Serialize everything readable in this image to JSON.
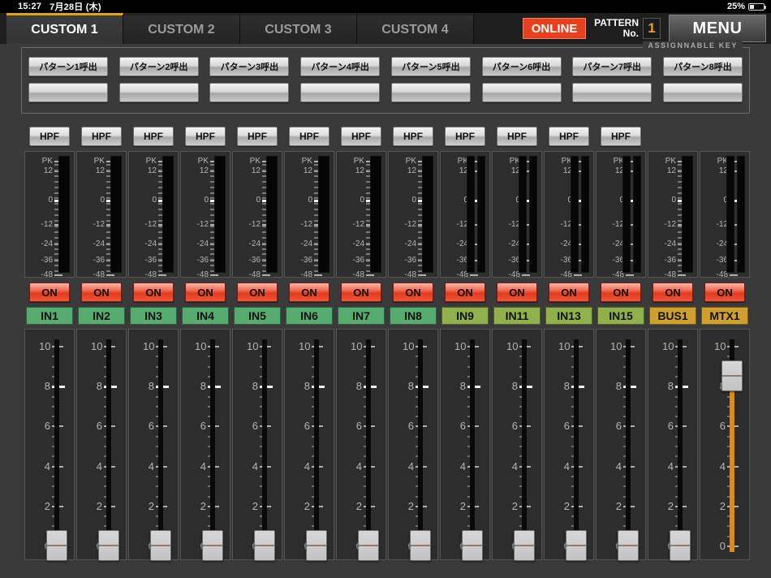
{
  "statusbar": {
    "time": "15:27",
    "date": "7月28日 (木)",
    "battery_percent": "25%"
  },
  "topbar": {
    "tabs": [
      {
        "label": "CUSTOM 1",
        "active": true
      },
      {
        "label": "CUSTOM 2",
        "active": false
      },
      {
        "label": "CUSTOM 3",
        "active": false
      },
      {
        "label": "CUSTOM 4",
        "active": false
      }
    ],
    "online_label": "ONLINE",
    "pattern_label_line1": "PATTERN",
    "pattern_label_line2": "No.",
    "pattern_number": "1",
    "menu_label": "MENU"
  },
  "assignable": {
    "caption": "ASSIGNNABLE KEY",
    "row1": [
      "パターン1呼出",
      "パターン2呼出",
      "パターン3呼出",
      "パターン4呼出",
      "パターン5呼出",
      "パターン6呼出",
      "パターン7呼出",
      "パターン8呼出"
    ],
    "row2": [
      "",
      "",
      "",
      "",
      "",
      "",
      "",
      ""
    ]
  },
  "meter": {
    "labels": [
      "PK",
      "12",
      "0",
      "-12",
      "-24",
      "-36",
      "-48"
    ]
  },
  "fader": {
    "labels": [
      "10",
      "8",
      "6",
      "4",
      "2",
      "0"
    ],
    "nominal_label": "8"
  },
  "colors": {
    "accent_orange": "#e8a317",
    "online_red": "#e8401f",
    "on_button_red": "#e03b21",
    "input_green": "#55ac6e",
    "input_green_alt": "#8fb04a",
    "bus_gold": "#cfa02e",
    "fader_lit": "#e08a16"
  },
  "channels": [
    {
      "name": "IN1",
      "hpf": "HPF",
      "on": "ON",
      "color": "#55ac6e",
      "meter_stereo": false,
      "fader_value": 0,
      "fader_lit": false
    },
    {
      "name": "IN2",
      "hpf": "HPF",
      "on": "ON",
      "color": "#55ac6e",
      "meter_stereo": false,
      "fader_value": 0,
      "fader_lit": false
    },
    {
      "name": "IN3",
      "hpf": "HPF",
      "on": "ON",
      "color": "#55ac6e",
      "meter_stereo": false,
      "fader_value": 0,
      "fader_lit": false
    },
    {
      "name": "IN4",
      "hpf": "HPF",
      "on": "ON",
      "color": "#55ac6e",
      "meter_stereo": false,
      "fader_value": 0,
      "fader_lit": false
    },
    {
      "name": "IN5",
      "hpf": "HPF",
      "on": "ON",
      "color": "#55ac6e",
      "meter_stereo": false,
      "fader_value": 0,
      "fader_lit": false
    },
    {
      "name": "IN6",
      "hpf": "HPF",
      "on": "ON",
      "color": "#55ac6e",
      "meter_stereo": false,
      "fader_value": 0,
      "fader_lit": false
    },
    {
      "name": "IN7",
      "hpf": "HPF",
      "on": "ON",
      "color": "#55ac6e",
      "meter_stereo": false,
      "fader_value": 0,
      "fader_lit": false
    },
    {
      "name": "IN8",
      "hpf": "HPF",
      "on": "ON",
      "color": "#55ac6e",
      "meter_stereo": false,
      "fader_value": 0,
      "fader_lit": false
    },
    {
      "name": "IN9",
      "hpf": "HPF",
      "on": "ON",
      "color": "#8fb04a",
      "meter_stereo": true,
      "fader_value": 0,
      "fader_lit": false
    },
    {
      "name": "IN11",
      "hpf": "HPF",
      "on": "ON",
      "color": "#8fb04a",
      "meter_stereo": true,
      "fader_value": 0,
      "fader_lit": false
    },
    {
      "name": "IN13",
      "hpf": "HPF",
      "on": "ON",
      "color": "#8fb04a",
      "meter_stereo": true,
      "fader_value": 0,
      "fader_lit": false
    },
    {
      "name": "IN15",
      "hpf": "HPF",
      "on": "ON",
      "color": "#8fb04a",
      "meter_stereo": true,
      "fader_value": 0,
      "fader_lit": false
    },
    {
      "name": "BUS1",
      "hpf": "",
      "on": "ON",
      "color": "#cfa02e",
      "meter_stereo": false,
      "fader_value": 0,
      "fader_lit": false
    },
    {
      "name": "MTX1",
      "hpf": "",
      "on": "ON",
      "color": "#cfa02e",
      "meter_stereo": true,
      "fader_value": 8.5,
      "fader_lit": true
    }
  ]
}
